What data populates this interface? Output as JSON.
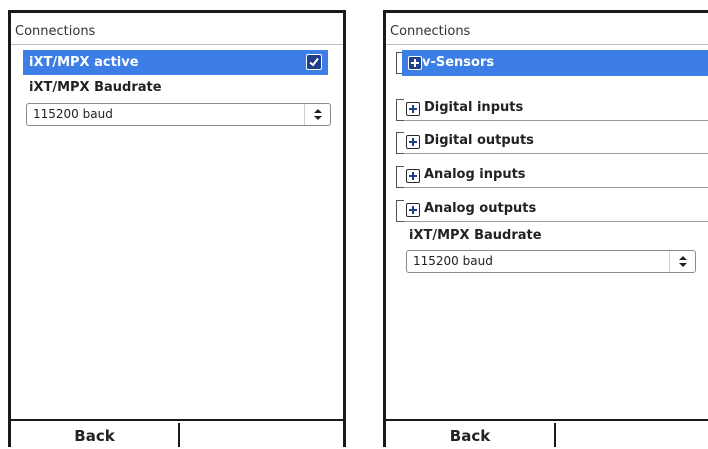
{
  "left_screen": {
    "title": "Connections",
    "selected_row": {
      "label": "iXT/MPX active",
      "checked": true
    },
    "baudrate_label": "iXT/MPX Baudrate",
    "baudrate_value": "115200 baud",
    "back_label": "Back"
  },
  "right_screen": {
    "title": "Connections",
    "tree_items": [
      {
        "label": "v-Sensors",
        "selected": true
      },
      {
        "label": "Digital inputs",
        "selected": false
      },
      {
        "label": "Digital outputs",
        "selected": false
      },
      {
        "label": "Analog inputs",
        "selected": false
      },
      {
        "label": "Analog outputs",
        "selected": false
      }
    ],
    "baudrate_label": "iXT/MPX Baudrate",
    "baudrate_value": "115200 baud",
    "back_label": "Back"
  },
  "colors": {
    "selection": "#3c7ee6",
    "checkbox": "#1f3f8a"
  }
}
